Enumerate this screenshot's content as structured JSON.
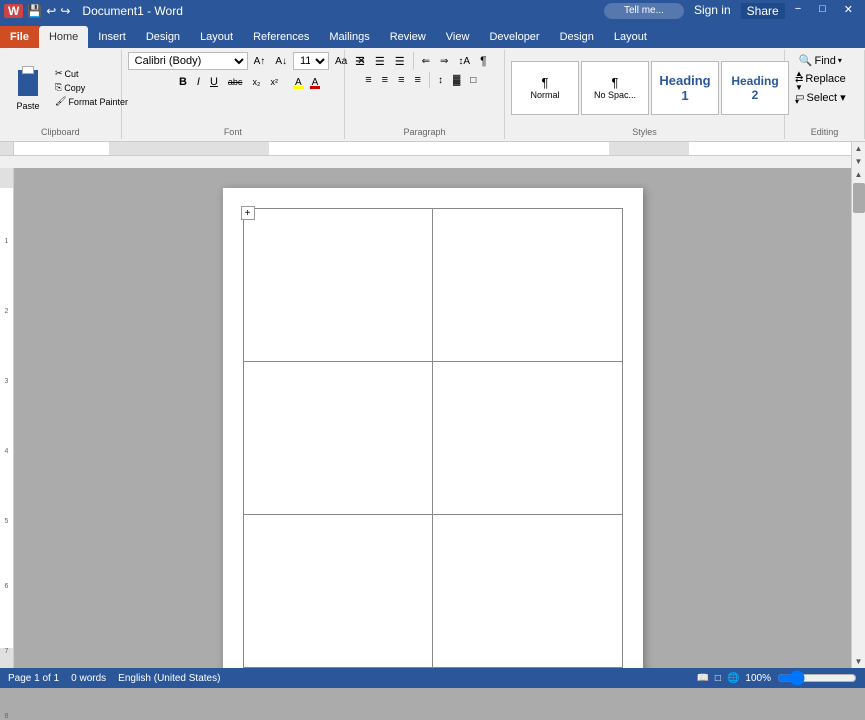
{
  "titlebar": {
    "title": "Document1 - Word",
    "file_label": "File",
    "tabs": [
      "File",
      "Home",
      "Insert",
      "Design",
      "Layout",
      "References",
      "Mailings",
      "Review",
      "View",
      "Developer",
      "Design",
      "Layout"
    ],
    "active_tab": "Home",
    "tell_me": "Tell me...",
    "sign_in": "Sign in",
    "share": "Share",
    "minimize": "−",
    "maximize": "□",
    "close": "✕"
  },
  "ribbon": {
    "clipboard": {
      "label": "Clipboard",
      "paste_label": "Paste",
      "cut_label": "Cut",
      "copy_label": "Copy",
      "format_painter": "Format Painter"
    },
    "font": {
      "label": "Font",
      "font_name": "Calibri (Body)",
      "font_size": "11",
      "bold": "B",
      "italic": "I",
      "underline": "U",
      "strikethrough": "abc",
      "subscript": "x₂",
      "superscript": "x²",
      "change_case": "Aa",
      "highlight": "A",
      "font_color": "A",
      "grow": "A↑",
      "shrink": "A↓",
      "clear": "✕"
    },
    "paragraph": {
      "label": "Paragraph",
      "bullets": "≡",
      "numbering": "≡",
      "multilevel": "≡",
      "decrease_indent": "⇐",
      "increase_indent": "⇒",
      "sort": "↕A",
      "show_marks": "¶",
      "align_left": "≡",
      "center": "≡",
      "align_right": "≡",
      "justify": "≡",
      "line_spacing": "≡",
      "shading": "▓",
      "borders": "□"
    },
    "styles": {
      "label": "Styles",
      "items": [
        {
          "name": "normal",
          "label": "¶ Normal",
          "style": "normal"
        },
        {
          "name": "no-spacing",
          "label": "¶ No Spac...",
          "style": "no-spacing"
        },
        {
          "name": "heading1",
          "label": "Heading 1",
          "style": "heading1"
        },
        {
          "name": "heading2",
          "label": "Heading 2",
          "style": "heading2"
        }
      ]
    },
    "editing": {
      "label": "Editing",
      "find": "Find",
      "replace": "Replace",
      "select": "Select ▾"
    }
  },
  "document": {
    "table": {
      "rows": 3,
      "cols": 2
    }
  },
  "statusbar": {
    "page_info": "Page 1 of 1",
    "word_count": "0 words",
    "language": "English (United States)",
    "zoom": "100%"
  }
}
